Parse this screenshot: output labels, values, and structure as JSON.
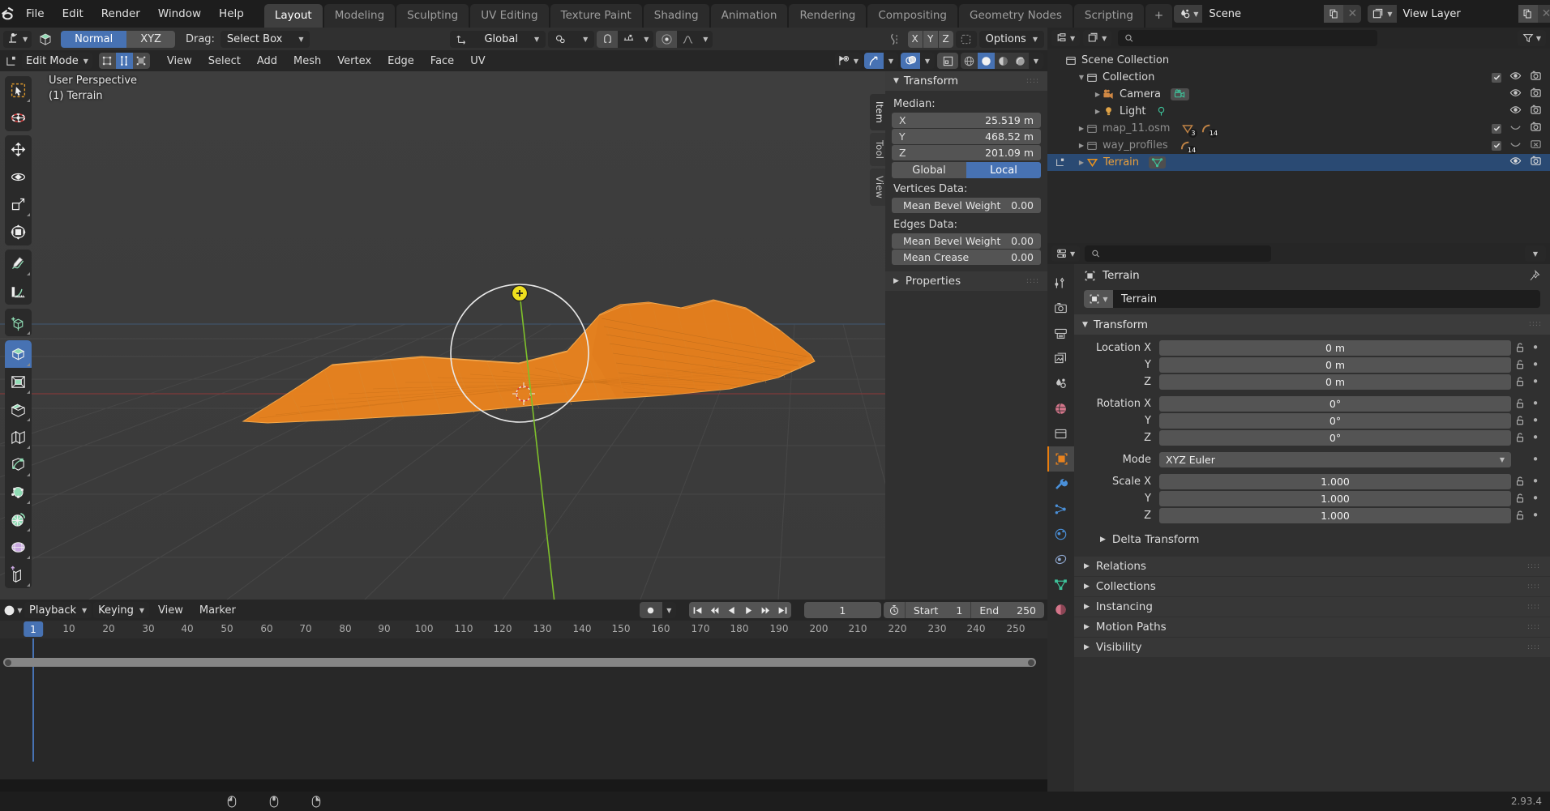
{
  "app": {
    "version": "2.93.4"
  },
  "topbar": {
    "menus": [
      "File",
      "Edit",
      "Render",
      "Window",
      "Help"
    ],
    "workspaces": [
      {
        "label": "Layout",
        "active": true
      },
      {
        "label": "Modeling",
        "active": false
      },
      {
        "label": "Sculpting",
        "active": false
      },
      {
        "label": "UV Editing",
        "active": false
      },
      {
        "label": "Texture Paint",
        "active": false
      },
      {
        "label": "Shading",
        "active": false
      },
      {
        "label": "Animation",
        "active": false
      },
      {
        "label": "Rendering",
        "active": false
      },
      {
        "label": "Compositing",
        "active": false
      },
      {
        "label": "Geometry Nodes",
        "active": false
      },
      {
        "label": "Scripting",
        "active": false
      }
    ],
    "add_workspace_label": "+",
    "scene_name": "Scene",
    "view_layer_name": "View Layer"
  },
  "tool_settings": {
    "orientation_options": [
      {
        "label": "Normal",
        "active": true
      },
      {
        "label": "XYZ",
        "active": false
      }
    ],
    "drag_label": "Drag:",
    "drag_value": "Select Box",
    "transform_orientation": "Global",
    "axis_buttons": [
      "X",
      "Y",
      "Z"
    ],
    "options_label": "Options"
  },
  "viewport_header": {
    "mode": "Edit Mode",
    "menus": [
      "View",
      "Select",
      "Add",
      "Mesh",
      "Vertex",
      "Edge",
      "Face",
      "UV"
    ],
    "select_modes": [
      {
        "name": "vertex-select-mode",
        "active": false
      },
      {
        "name": "edge-select-mode",
        "active": true
      },
      {
        "name": "face-select-mode",
        "active": false
      }
    ],
    "shading_modes": [
      {
        "name": "wireframe-shading",
        "active": false
      },
      {
        "name": "solid-shading",
        "active": true
      },
      {
        "name": "material-preview-shading",
        "active": false
      },
      {
        "name": "rendered-shading",
        "active": false
      }
    ]
  },
  "viewport": {
    "perspective_label": "User Perspective",
    "object_label": "(1) Terrain",
    "gizmo_axes": [
      "X",
      "Y",
      "Z"
    ],
    "tools": [
      {
        "name": "tweak-tool",
        "active": false
      },
      {
        "name": "cursor-tool",
        "active": false
      },
      {
        "name": "move-tool",
        "active": false
      },
      {
        "name": "rotate-tool",
        "active": false
      },
      {
        "name": "scale-tool",
        "active": false
      },
      {
        "name": "transform-tool",
        "active": false
      },
      {
        "name": "annotate-tool",
        "active": false
      },
      {
        "name": "measure-tool",
        "active": false
      },
      {
        "name": "add-cube-tool",
        "active": false
      },
      {
        "name": "extrude-region-tool",
        "active": true
      },
      {
        "name": "inset-faces-tool",
        "active": false
      },
      {
        "name": "bevel-tool",
        "active": false
      },
      {
        "name": "loop-cut-tool",
        "active": false
      },
      {
        "name": "knife-tool",
        "active": false
      },
      {
        "name": "poly-build-tool",
        "active": false
      },
      {
        "name": "spin-tool",
        "active": false
      },
      {
        "name": "smooth-tool",
        "active": false
      },
      {
        "name": "shrink-fatten-tool",
        "active": false
      }
    ],
    "nav_buttons": [
      "zoom-icon",
      "pan-hand-icon",
      "camera-view-icon",
      "toggle-perspective-icon"
    ]
  },
  "npanel": {
    "tabs": [
      {
        "label": "Item",
        "active": true
      },
      {
        "label": "Tool",
        "active": false
      },
      {
        "label": "View",
        "active": false
      }
    ],
    "transform_title": "Transform",
    "median_label": "Median:",
    "median": [
      {
        "axis": "X",
        "value": "25.519 m"
      },
      {
        "axis": "Y",
        "value": "468.52 m"
      },
      {
        "axis": "Z",
        "value": "201.09 m"
      }
    ],
    "space_options": [
      {
        "label": "Global",
        "active": false
      },
      {
        "label": "Local",
        "active": true
      }
    ],
    "vertices_data_label": "Vertices Data:",
    "vertices_data": [
      {
        "label": "Mean Bevel Weight",
        "value": "0.00"
      }
    ],
    "edges_data_label": "Edges Data:",
    "edges_data": [
      {
        "label": "Mean Bevel Weight",
        "value": "0.00"
      },
      {
        "label": "Mean Crease",
        "value": "0.00"
      }
    ],
    "properties_title": "Properties"
  },
  "outliner": {
    "search_placeholder": "",
    "rows": [
      {
        "indent": 0,
        "name": "Scene Collection",
        "icon": "collection-icon",
        "dim": false,
        "selected": false,
        "expander": "",
        "checkbox": false,
        "eye": false,
        "camera": false
      },
      {
        "indent": 1,
        "name": "Collection",
        "icon": "collection-icon",
        "dim": false,
        "selected": false,
        "expander": "down",
        "checkbox": true,
        "eye": true,
        "camera": true
      },
      {
        "indent": 2,
        "name": "Camera",
        "icon": "camera-data-icon",
        "dim": false,
        "selected": false,
        "expander": "right",
        "checkbox": false,
        "eye": true,
        "camera": true
      },
      {
        "indent": 2,
        "name": "Light",
        "icon": "light-data-icon",
        "dim": false,
        "selected": false,
        "expander": "right",
        "checkbox": false,
        "eye": true,
        "camera": true
      },
      {
        "indent": 1,
        "name": "map_11.osm",
        "icon": "collection-icon",
        "dim": true,
        "selected": false,
        "expander": "right",
        "checkbox": true,
        "eye": true,
        "camera": true,
        "badges": [
          "3",
          "14"
        ]
      },
      {
        "indent": 1,
        "name": "way_profiles",
        "icon": "collection-icon",
        "dim": true,
        "selected": false,
        "expander": "right",
        "checkbox": true,
        "eye": true,
        "camera": true,
        "badges": [
          "14"
        ]
      },
      {
        "indent": 1,
        "name": "Terrain",
        "icon": "mesh-object-icon",
        "dim": false,
        "selected": true,
        "expander": "right",
        "checkbox": false,
        "eye": true,
        "camera": true
      }
    ]
  },
  "properties": {
    "breadcrumb_object": "Terrain",
    "object_name_value": "Terrain",
    "search_placeholder": "",
    "tabs": [
      {
        "name": "tool-tab",
        "active": false
      },
      {
        "name": "render-tab",
        "active": false
      },
      {
        "name": "output-tab",
        "active": false
      },
      {
        "name": "view-layer-tab",
        "active": false
      },
      {
        "name": "scene-tab",
        "active": false
      },
      {
        "name": "world-tab",
        "active": false
      },
      {
        "name": "collection-tab",
        "active": false
      },
      {
        "name": "object-tab",
        "active": true
      },
      {
        "name": "modifier-tab",
        "active": false
      },
      {
        "name": "particles-tab",
        "active": false
      },
      {
        "name": "physics-tab",
        "active": false
      },
      {
        "name": "constraints-tab",
        "active": false
      },
      {
        "name": "object-data-tab",
        "active": false
      },
      {
        "name": "material-tab",
        "active": false
      }
    ],
    "transform_title": "Transform",
    "location": [
      {
        "label": "Location X",
        "value": "0 m"
      },
      {
        "label": "Y",
        "value": "0 m"
      },
      {
        "label": "Z",
        "value": "0 m"
      }
    ],
    "rotation": [
      {
        "label": "Rotation X",
        "value": "0°"
      },
      {
        "label": "Y",
        "value": "0°"
      },
      {
        "label": "Z",
        "value": "0°"
      }
    ],
    "mode_label": "Mode",
    "mode_value": "XYZ Euler",
    "scale": [
      {
        "label": "Scale X",
        "value": "1.000"
      },
      {
        "label": "Y",
        "value": "1.000"
      },
      {
        "label": "Z",
        "value": "1.000"
      }
    ],
    "delta_transform_label": "Delta Transform",
    "closed_panels": [
      "Relations",
      "Collections",
      "Instancing",
      "Motion Paths",
      "Visibility"
    ]
  },
  "timeline": {
    "menus": [
      "Playback",
      "Keying",
      "View",
      "Marker"
    ],
    "dropdown_menus": [
      "Playback",
      "Keying"
    ],
    "plain_menus": [
      "View",
      "Marker"
    ],
    "transport": [
      "jump-to-start-icon",
      "jump-prev-keyframe-icon",
      "play-reverse-icon",
      "play-icon",
      "jump-next-keyframe-icon",
      "jump-to-end-icon"
    ],
    "current_frame": "1",
    "start_label": "Start",
    "start_value": "1",
    "end_label": "End",
    "end_value": "250",
    "ruler_ticks": [
      "1",
      "10",
      "20",
      "30",
      "40",
      "50",
      "60",
      "70",
      "80",
      "90",
      "100",
      "110",
      "120",
      "130",
      "140",
      "150",
      "160",
      "170",
      "180",
      "190",
      "200",
      "210",
      "220",
      "230",
      "240",
      "250"
    ],
    "playhead_frame": "1"
  },
  "statusbar": {
    "items": [
      {
        "icon": "mouse-left-icon",
        "label": ""
      },
      {
        "icon": "mouse-middle-icon",
        "label": ""
      },
      {
        "icon": "mouse-right-icon",
        "label": ""
      }
    ],
    "version": "2.93.4"
  },
  "colors": {
    "accent_blue": "#4772b3",
    "selected_orange": "#eba03b",
    "mesh_orange": "#e8821e",
    "background": "#3b3b3b",
    "panel": "#303030",
    "header": "#262626"
  }
}
